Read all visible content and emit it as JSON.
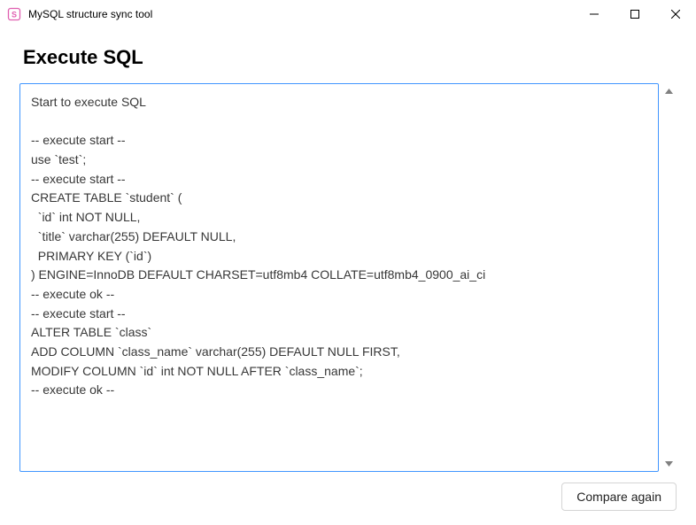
{
  "window": {
    "title": "MySQL structure sync tool"
  },
  "page": {
    "heading": "Execute SQL"
  },
  "log": {
    "text": "Start to execute SQL\n\n-- execute start --\nuse `test`;\n-- execute start --\nCREATE TABLE `student` (\n  `id` int NOT NULL,\n  `title` varchar(255) DEFAULT NULL,\n  PRIMARY KEY (`id`)\n) ENGINE=InnoDB DEFAULT CHARSET=utf8mb4 COLLATE=utf8mb4_0900_ai_ci\n-- execute ok --\n-- execute start --\nALTER TABLE `class`\nADD COLUMN `class_name` varchar(255) DEFAULT NULL FIRST,\nMODIFY COLUMN `id` int NOT NULL AFTER `class_name`;\n-- execute ok --"
  },
  "footer": {
    "compare_again_label": "Compare again"
  }
}
